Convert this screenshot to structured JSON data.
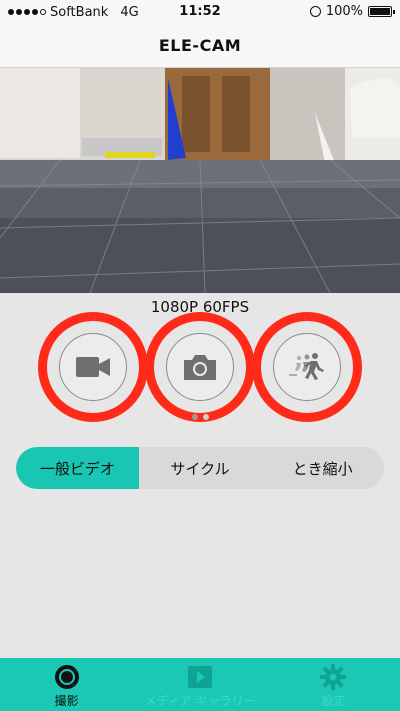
{
  "status_bar": {
    "carrier": "SoftBank",
    "network": "4G",
    "time": "11:52",
    "battery_text": "100%",
    "battery_level": 1.0
  },
  "app": {
    "title": "ELE-CAM"
  },
  "controls": {
    "resolution": "1080P 60FPS",
    "mode_buttons": [
      {
        "icon": "video-camera-icon",
        "highlighted": true
      },
      {
        "icon": "camera-icon",
        "highlighted": true
      },
      {
        "icon": "timelapse-runner-icon",
        "highlighted": true
      }
    ],
    "page_dots": {
      "count": 2,
      "active": 0
    },
    "segments": [
      {
        "label": "一般ビデオ",
        "active": true
      },
      {
        "label": "サイクル",
        "active": false
      },
      {
        "label": "とき縮小",
        "active": false
      }
    ]
  },
  "tab_bar": {
    "items": [
      {
        "label": "撮影",
        "icon": "camera-lens-icon",
        "active": true
      },
      {
        "label": "メディア ギャラリー",
        "icon": "play-icon",
        "active": false
      },
      {
        "label": "設定",
        "icon": "gear-icon",
        "active": false
      }
    ]
  },
  "colors": {
    "accent": "#1bc8b6",
    "highlight_ring": "#ff2a1a",
    "background": "#e6e6e6"
  }
}
